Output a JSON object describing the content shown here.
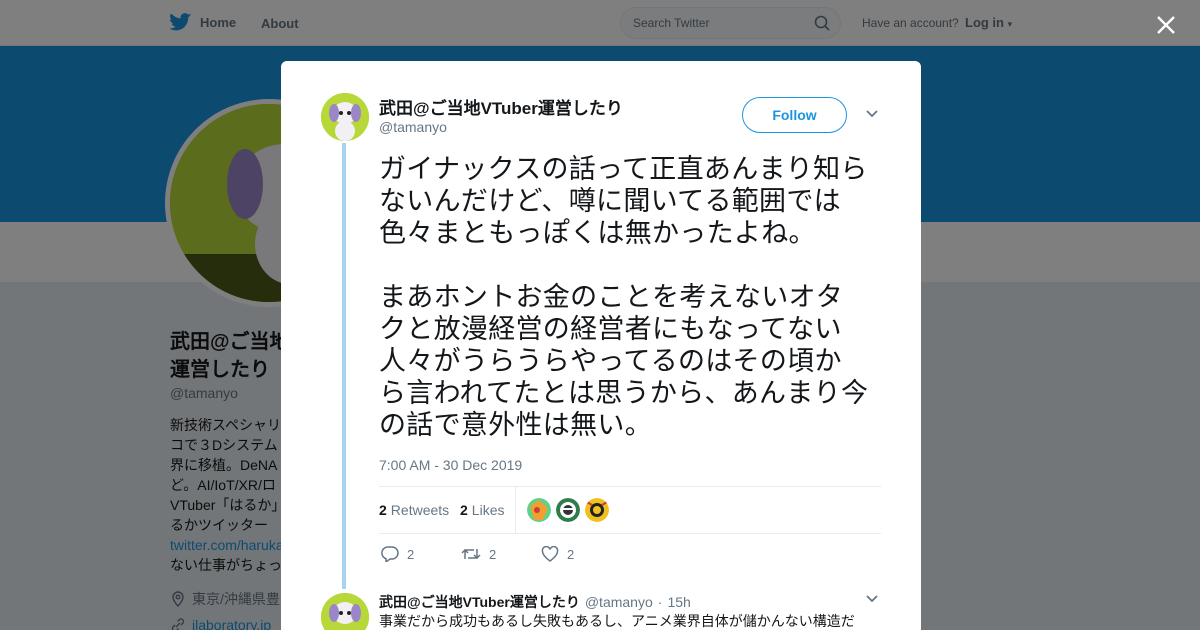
{
  "nav": {
    "home_label": "Home",
    "about_label": "About",
    "search_placeholder": "Search Twitter",
    "have_account_label": "Have an account?",
    "login_label": "Log in"
  },
  "profile": {
    "name": "武田@ご当地VTuber運営したり",
    "handle": "@tamanyo",
    "bio_lines": "新技術スペシャリ\nコで３Dシステム\n界に移植。DeNA\nど。AI/IoT/XR/ロ\nVTuber「はるか」\nるかツイッター\n",
    "bio_url": "twitter.com/haruka",
    "bio_tail": "\nない仕事がちょっ",
    "location": "東京/沖縄県豊",
    "website": "ilaboratory.jp"
  },
  "tweet": {
    "author_name": "武田@ご当地VTuber運営したり",
    "author_handle": "@tamanyo",
    "follow_label": "Follow",
    "text": "ガイナックスの話って正直あんまり知らないんだけど、噂に聞いてる範囲では色々まともっぽくは無かったよね。\n\nまあホントお金のことを考えないオタクと放漫経営の経営者にもなってない人々がうらうらやってるのはその頃から言われてたとは思うから、あんまり今の話で意外性は無い。",
    "timestamp": "7:00 AM - 30 Dec 2019",
    "retweets_count": "2",
    "retweets_label": "Retweets",
    "likes_count": "2",
    "likes_label": "Likes",
    "reply_count": "2",
    "retweet_action_count": "2",
    "like_action_count": "2"
  },
  "reply": {
    "author_name": "武田@ご当地VTuber運営したり",
    "author_handle": "@tamanyo",
    "separator": "·",
    "time": "15h",
    "text": "事業だから成功もあるし失敗もあるし、アニメ業界自体が儲かんない構造だ"
  },
  "colors": {
    "brand_blue": "#1b95e0",
    "thread_line": "#a6d3ee",
    "muted_text": "#657786"
  }
}
